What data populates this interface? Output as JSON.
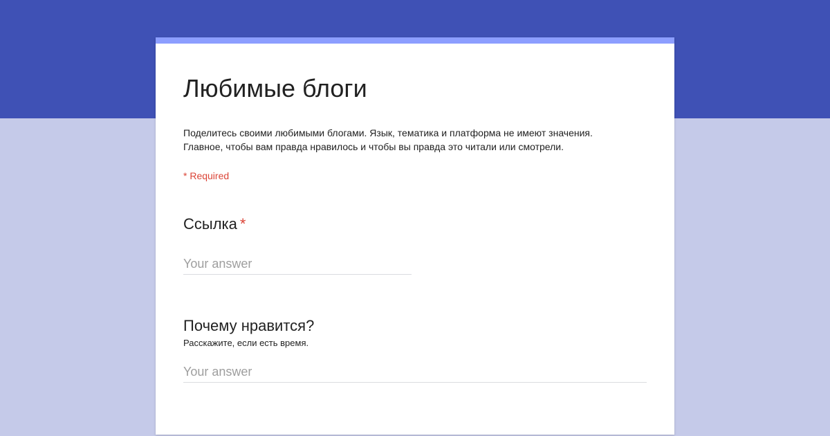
{
  "form": {
    "title": "Любимые блоги",
    "description_lines": [
      "Поделитесь своими любимыми блогами. Язык, тематика и платформа не имеют значения.",
      "Главное, чтобы вам правда нравилось и чтобы вы правда это читали или смотрели."
    ],
    "required_note": "* Required"
  },
  "questions": [
    {
      "title": "Ссылка",
      "required_mark": "*",
      "placeholder": "Your answer",
      "value": ""
    },
    {
      "title": "Почему нравится?",
      "help": "Расскажите, если есть время.",
      "placeholder": "Your answer",
      "value": ""
    }
  ],
  "colors": {
    "header_band": "#3f51b5",
    "page_background": "#c5cae9",
    "card_accent": "#8c9eff",
    "required": "#db4437"
  }
}
